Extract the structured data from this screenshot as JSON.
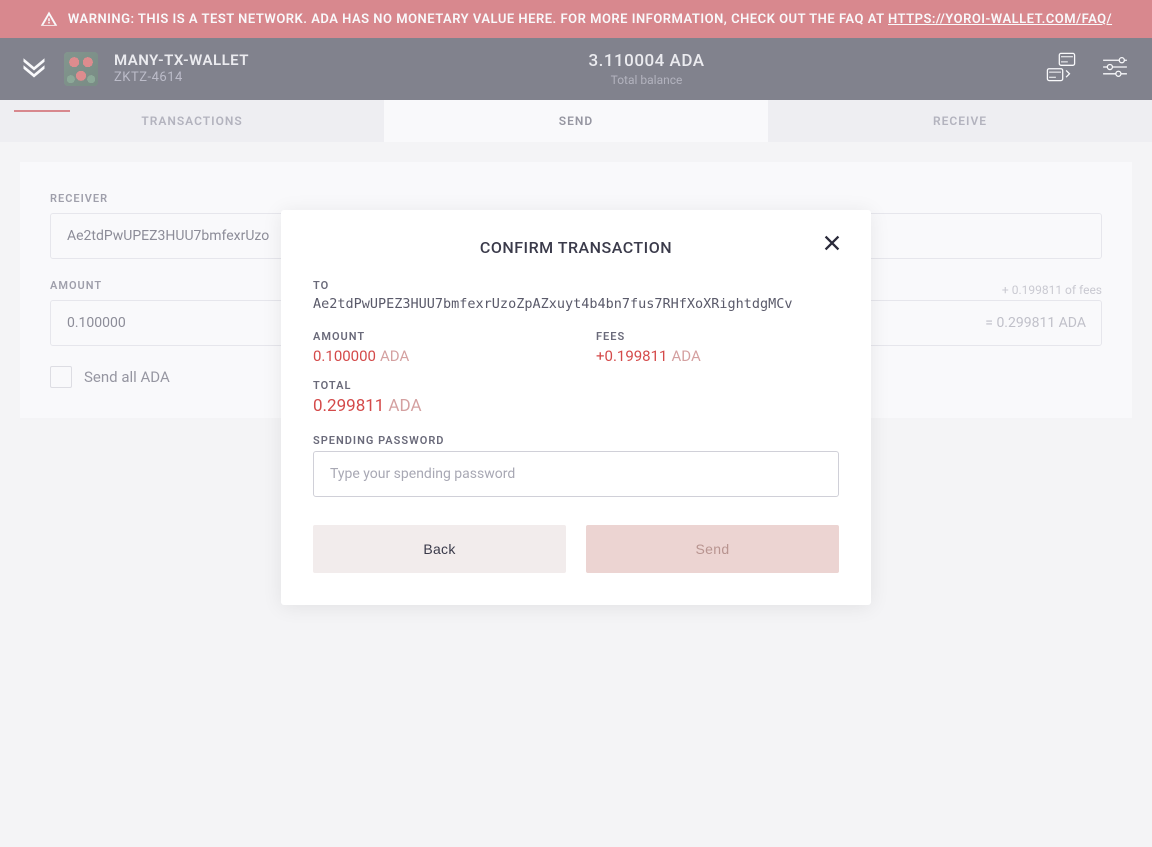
{
  "warning": {
    "text": "WARNING: THIS IS A TEST NETWORK. ADA HAS NO MONETARY VALUE HERE. FOR MORE INFORMATION, CHECK OUT THE FAQ AT ",
    "link_text": "HTTPS://YOROI-WALLET.COM/FAQ/"
  },
  "header": {
    "wallet_name": "MANY-TX-WALLET",
    "wallet_id": "ZKTZ-4614",
    "balance_amount": "3.110004 ADA",
    "balance_label": "Total balance"
  },
  "tabs": {
    "transactions": "TRANSACTIONS",
    "send": "SEND",
    "receive": "RECEIVE"
  },
  "form": {
    "receiver_label": "RECEIVER",
    "receiver_value": "Ae2tdPwUPEZ3HUU7bmfexrUzo",
    "amount_label": "AMOUNT",
    "amount_value": "0.100000",
    "fees_hint": "+ 0.199811 of fees",
    "total_hint": "= 0.299811 ADA",
    "send_all_label": "Send all ADA"
  },
  "modal": {
    "title": "CONFIRM TRANSACTION",
    "to_label": "TO",
    "to_address": "Ae2tdPwUPEZ3HUU7bmfexrUzoZpAZxuyt4b4bn7fus7RHfXoXRightdgMCv",
    "amount_label": "AMOUNT",
    "amount_value": "0.100000",
    "amount_currency": "ADA",
    "fees_label": "FEES",
    "fees_value": "+0.199811",
    "fees_currency": "ADA",
    "total_label": "TOTAL",
    "total_value": "0.299811",
    "total_currency": "ADA",
    "password_label": "SPENDING PASSWORD",
    "password_placeholder": "Type your spending password",
    "back_button": "Back",
    "send_button": "Send"
  }
}
